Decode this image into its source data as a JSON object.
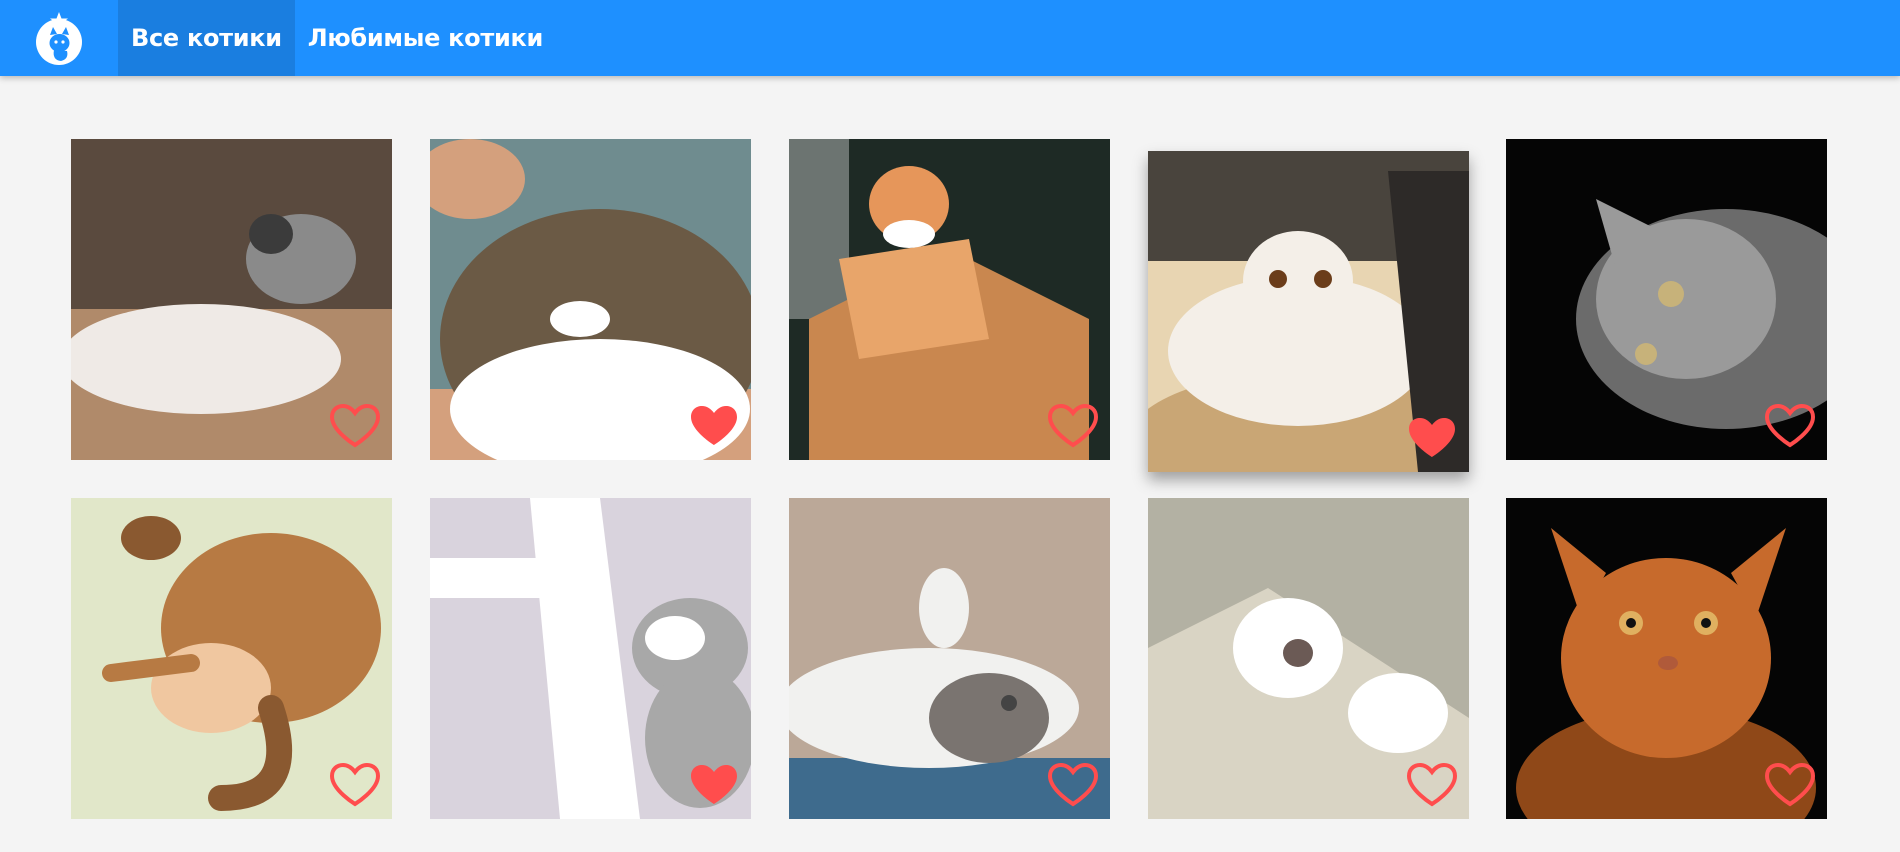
{
  "header": {
    "logo_icon": "cat-star-logo-icon",
    "tabs": [
      {
        "label": "Все котики",
        "active": true
      },
      {
        "label": "Любимые котики",
        "active": false
      }
    ]
  },
  "colors": {
    "header_bg": "#1e90ff",
    "active_tab_bg": "#1a7ee0",
    "page_bg": "#f4f4f4",
    "heart": "#ff4d4d"
  },
  "cats": [
    {
      "name": "kitten-on-white-cat",
      "favorite": false,
      "palette": [
        "#5a4a3e",
        "#efeae6",
        "#3b3b3b",
        "#8a8a8a"
      ]
    },
    {
      "name": "scottish-fold-tabby",
      "favorite": true,
      "palette": [
        "#6f8c8f",
        "#ffffff",
        "#6b5a45",
        "#d4a07d"
      ]
    },
    {
      "name": "kitten-cardboard-tank",
      "favorite": false,
      "palette": [
        "#1e2a25",
        "#c9874f",
        "#e8a56a",
        "#ffffff"
      ]
    },
    {
      "name": "white-fold-on-chair",
      "favorite": true,
      "palette": [
        "#c9a675",
        "#f4efe8",
        "#2d2a28",
        "#e8d5b2"
      ]
    },
    {
      "name": "grey-tabby-black-bg",
      "favorite": false,
      "palette": [
        "#050505",
        "#9a9a9a",
        "#6b6b6b",
        "#c7b27a"
      ]
    },
    {
      "name": "ginger-cat-sleeping",
      "favorite": false,
      "palette": [
        "#e1e7c9",
        "#b77a43",
        "#8a5930",
        "#f0c7a0"
      ]
    },
    {
      "name": "cat-in-cherry-tree",
      "favorite": true,
      "palette": [
        "#d9d3dd",
        "#3c3a35",
        "#ffffff",
        "#a8a8a8"
      ]
    },
    {
      "name": "fluffy-cat-lying",
      "favorite": false,
      "palette": [
        "#bba898",
        "#f1f1ef",
        "#7a7470",
        "#3e6b8d"
      ]
    },
    {
      "name": "cat-paws-carpet",
      "favorite": false,
      "palette": [
        "#9a9a8e",
        "#ffffff",
        "#5a4a38",
        "#d9d4c4"
      ]
    },
    {
      "name": "somali-cat-portrait",
      "favorite": false,
      "palette": [
        "#050505",
        "#c76a2c",
        "#8f4818",
        "#e0b060"
      ]
    }
  ]
}
